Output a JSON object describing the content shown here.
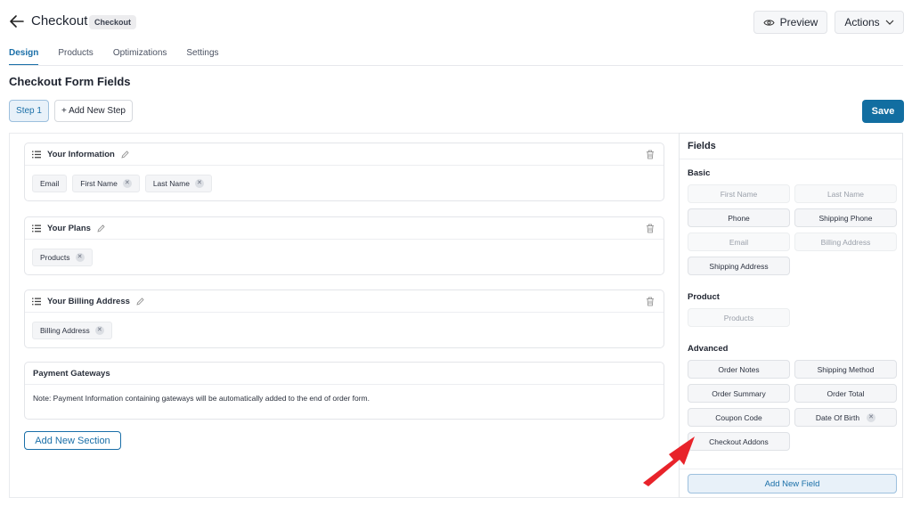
{
  "header": {
    "title": "Checkout",
    "badge": "Checkout",
    "preview_label": "Preview",
    "actions_label": "Actions"
  },
  "tabs": [
    {
      "label": "Design",
      "active": true
    },
    {
      "label": "Products",
      "active": false
    },
    {
      "label": "Optimizations",
      "active": false
    },
    {
      "label": "Settings",
      "active": false
    }
  ],
  "heading": "Checkout Form Fields",
  "steps": {
    "step_label": "Step 1",
    "add_step_label": "+ Add New Step"
  },
  "save_label": "Save",
  "sections": [
    {
      "title": "Your Information",
      "chips": [
        {
          "label": "Email",
          "removable": false
        },
        {
          "label": "First Name",
          "removable": true
        },
        {
          "label": "Last Name",
          "removable": true
        }
      ]
    },
    {
      "title": "Your Plans",
      "chips": [
        {
          "label": "Products",
          "removable": true
        }
      ]
    },
    {
      "title": "Your Billing Address",
      "chips": [
        {
          "label": "Billing Address",
          "removable": true
        }
      ]
    }
  ],
  "payment": {
    "title": "Payment Gateways",
    "note": "Note: Payment Information containing gateways will be automatically added to the end of order form."
  },
  "add_section_label": "Add New Section",
  "fields_panel": {
    "title": "Fields",
    "groups": {
      "basic": "Basic",
      "product": "Product",
      "advanced": "Advanced"
    },
    "basic_fields": [
      {
        "label": "First Name",
        "disabled": true
      },
      {
        "label": "Last Name",
        "disabled": true
      },
      {
        "label": "Phone",
        "disabled": false
      },
      {
        "label": "Shipping Phone",
        "disabled": false
      },
      {
        "label": "Email",
        "disabled": true
      },
      {
        "label": "Billing Address",
        "disabled": true
      },
      {
        "label": "Shipping Address",
        "disabled": false
      }
    ],
    "product_fields": [
      {
        "label": "Products",
        "disabled": true
      }
    ],
    "advanced_fields": [
      {
        "label": "Order Notes",
        "disabled": false
      },
      {
        "label": "Shipping Method",
        "disabled": false
      },
      {
        "label": "Order Summary",
        "disabled": false
      },
      {
        "label": "Order Total",
        "disabled": false
      },
      {
        "label": "Coupon Code",
        "disabled": false
      },
      {
        "label": "Date Of Birth",
        "disabled": false,
        "removable": true
      },
      {
        "label": "Checkout Addons",
        "disabled": false
      }
    ],
    "add_field_label": "Add New Field"
  },
  "colors": {
    "accent": "#1a6fa8",
    "save": "#126ea1",
    "arrow": "#e8232a"
  }
}
